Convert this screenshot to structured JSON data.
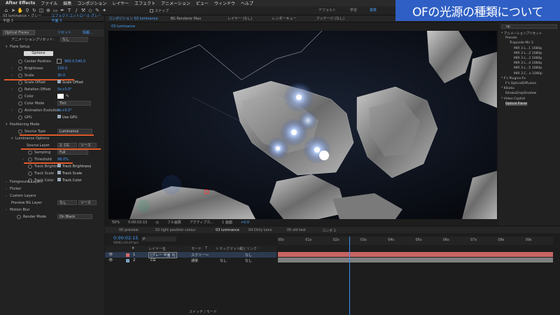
{
  "menubar": {
    "app": "After Effects",
    "items": [
      "ファイル",
      "編集",
      "コンポジション",
      "レイヤー",
      "エフェクト",
      "アニメーション",
      "ビュー",
      "ウィンドウ",
      "ヘルプ"
    ]
  },
  "toolbar": {
    "snap_label": "スナップ",
    "workspaces": [
      "デフォルト",
      "学習",
      "標準"
    ]
  },
  "title_banner": "OFの光源の種類について",
  "left_panel": {
    "header_tabs": [
      "03 luminance • グレー 平面 3",
      "エフェクトコントロール グレー 平面 3",
      "プロパ"
    ],
    "effect_name": "Optical Flares",
    "reset_label": "リセット",
    "about_label": "情報...",
    "preset_label": "アニメーションプリセット:",
    "preset_value": "なし",
    "flare_setup": "Flare Setup",
    "options_button": "Options",
    "props": [
      {
        "name": "Center Position",
        "value": "960.0,540.0"
      },
      {
        "name": "Brightness",
        "value": "100.0"
      },
      {
        "name": "Scale",
        "value": "30.0"
      },
      {
        "name": "Scale Offset",
        "value": "Scale Offset"
      },
      {
        "name": "Rotation Offset",
        "value": "0x+0.0°"
      },
      {
        "name": "Color",
        "value": ""
      },
      {
        "name": "Color Mode",
        "value": "Tint"
      },
      {
        "name": "Animation Evolution",
        "value": "0x+0.0°"
      },
      {
        "name": "GPU",
        "value": "Use GPU"
      }
    ],
    "positioning_mode": "Positioning Mode",
    "source_type_label": "Source Type",
    "source_type_value": "Luminance",
    "luminance_options": "Luminance Options",
    "source_layer_label": "Source Layer",
    "source_layer_value": "2. CG",
    "source_layer_extra": "ソース",
    "sampling_label": "Sampling",
    "sampling_value": "Full",
    "threshold_label": "Threshold",
    "threshold_value": "98.0%",
    "track_rows": [
      {
        "a": "Track Brightne",
        "b": "Track Brightness"
      },
      {
        "a": "Track Scale",
        "b": "Track Scale"
      },
      {
        "a": "Track Color",
        "b": "Track Color"
      }
    ],
    "sections": [
      "Foreground Layers",
      "Flicker",
      "Custom Layers"
    ],
    "preview_bg_label": "Preview BG Layer",
    "preview_bg_value": "なし",
    "preview_bg_extra": "ソース",
    "motion_blur": "Motion Blur",
    "render_mode_label": "Render Mode",
    "render_mode_value": "On Black"
  },
  "viewer": {
    "tabs": [
      "コンポジション 03 luminance",
      "BG Renderer Max",
      "レイヤー (なし)",
      "レンダーキュー",
      "フッテージ (なし)"
    ],
    "comp_tab": "03 luminance",
    "controls": [
      "0:00:02:15",
      "フル画質",
      "アクティブカ...",
      "1 画面",
      "+0.0"
    ],
    "zoom": "50%"
  },
  "right_panel": {
    "search_value": "op",
    "tree": [
      {
        "label": "* アニメーションプリセット",
        "indent": 0
      },
      {
        "label": "Presets",
        "indent": 1
      },
      {
        "label": "Trapcode Mir 3",
        "indent": 2
      },
      {
        "label": "MIR 3 L...1 1080p",
        "indent": 3
      },
      {
        "label": "MIR 3 L...2 1080p",
        "indent": 3
      },
      {
        "label": "MIR 3 L...3 1080p",
        "indent": 3
      },
      {
        "label": "MIR 3 L...4 1080p",
        "indent": 3
      },
      {
        "label": "MIR 3 L...5 1080p",
        "indent": 3
      },
      {
        "label": "MIR 3 C...e 1080p",
        "indent": 3
      },
      {
        "label": "* F's Plugins-Fx",
        "indent": 0
      },
      {
        "label": "F's OpticalDiffusion",
        "indent": 1
      },
      {
        "label": "* Kikaku",
        "indent": 0
      },
      {
        "label": "KikakuDropShadow",
        "indent": 1
      },
      {
        "label": "* Video Copilot",
        "indent": 0
      },
      {
        "label": "Optical Flares",
        "indent": 1
      }
    ]
  },
  "timeline": {
    "tabs": [
      "00 preview",
      "02 light position colour",
      "03 luminance",
      "04 Dirty Lens",
      "05 old test",
      "コンポ 1"
    ],
    "timecode": "0:00:02:15",
    "frames": "00063 (24.00 fps)",
    "search_placeholder": "ρ",
    "headers": [
      "#",
      "レイヤー名",
      "モード",
      "T",
      "トラックマット",
      "親とリンク"
    ],
    "layers": [
      {
        "num": "1",
        "name": "[グレー 平面 3]",
        "mode": "スクリー～",
        "matte": "",
        "parent": "なし",
        "color": "#d96a6a"
      },
      {
        "num": "2",
        "name": "CG",
        "mode": "通常",
        "matte": "なし",
        "parent": "なし",
        "color": "#7a9fbf"
      }
    ],
    "ruler": [
      "00s",
      "01s",
      "02s",
      "03s",
      "04s",
      "05s",
      "06s",
      "07s",
      "08s",
      "09s"
    ],
    "playhead_time_s": 2.6,
    "footer": "スイッチ / モード"
  }
}
